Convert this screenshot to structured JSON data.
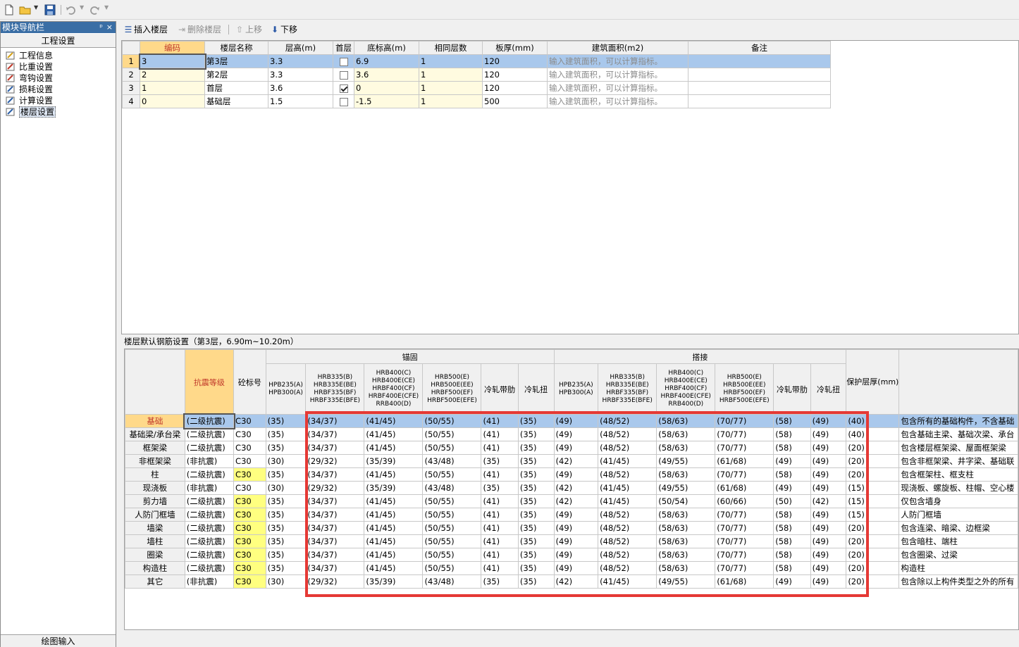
{
  "toolbar": {
    "icons": [
      "new-file-icon",
      "open-folder-icon",
      "save-icon",
      "undo-icon",
      "redo-icon"
    ]
  },
  "nav": {
    "title": "模块导航栏",
    "pin": "ᵖ",
    "close": "×",
    "header": "工程设置",
    "items": [
      {
        "label": "工程信息",
        "icon": "project-info-icon"
      },
      {
        "label": "比重设置",
        "icon": "density-settings-icon"
      },
      {
        "label": "弯钩设置",
        "icon": "hook-settings-icon"
      },
      {
        "label": "损耗设置",
        "icon": "loss-settings-icon"
      },
      {
        "label": "计算设置",
        "icon": "calc-settings-icon"
      },
      {
        "label": "楼层设置",
        "icon": "floor-settings-icon"
      }
    ],
    "bottom_tab": "绘图输入"
  },
  "floor_toolbar": {
    "insert": "插入楼层",
    "delete": "删除楼层",
    "up": "上移",
    "down": "下移"
  },
  "floor_table": {
    "headers": [
      "编码",
      "楼层名称",
      "层高(m)",
      "首层",
      "底标高(m)",
      "相同层数",
      "板厚(mm)",
      "建筑面积(m2)",
      "备注"
    ],
    "rows": [
      {
        "n": "1",
        "code": "3",
        "name": "第3层",
        "height": "3.3",
        "first": false,
        "base": "6.9",
        "same": "1",
        "thick": "120",
        "area": "输入建筑面积，可以计算指标。",
        "note": ""
      },
      {
        "n": "2",
        "code": "2",
        "name": "第2层",
        "height": "3.3",
        "first": false,
        "base": "3.6",
        "same": "1",
        "thick": "120",
        "area": "输入建筑面积，可以计算指标。",
        "note": ""
      },
      {
        "n": "3",
        "code": "1",
        "name": "首层",
        "height": "3.6",
        "first": true,
        "base": "0",
        "same": "1",
        "thick": "120",
        "area": "输入建筑面积，可以计算指标。",
        "note": ""
      },
      {
        "n": "4",
        "code": "0",
        "name": "基础层",
        "height": "1.5",
        "first": false,
        "base": "-1.5",
        "same": "1",
        "thick": "500",
        "area": "输入建筑面积，可以计算指标。",
        "note": ""
      }
    ]
  },
  "caption": "楼层默认钢筋设置（第3层，6.90m~10.20m）",
  "rebar": {
    "group_anchor": "锚固",
    "group_lap": "搭接",
    "h_seismic": "抗震等级",
    "h_concrete": "砼标号",
    "h_cover": "保护层厚(mm)",
    "grades": [
      "HPB235(A)\nHPB300(A)",
      "HRB335(B)\nHRB335E(BE)\nHRBF335(BF)\nHRBF335E(BFE)",
      "HRB400(C)\nHRB400E(CE)\nHRBF400(CF)\nHRBF400E(CFE)\nRRB400(D)",
      "HRB500(E)\nHRB500E(EE)\nHRBF500(EF)\nHRBF500E(EFE)",
      "冷轧带肋",
      "冷轧扭"
    ],
    "rows": [
      {
        "name": "基础",
        "seismic": "(二级抗震)",
        "concrete": "C30",
        "yellow": false,
        "anchor": [
          "(35)",
          "(34/37)",
          "(41/45)",
          "(50/55)",
          "(41)",
          "(35)"
        ],
        "lap": [
          "(49)",
          "(48/52)",
          "(58/63)",
          "(70/77)",
          "(58)",
          "(49)"
        ],
        "cover": "(40)",
        "note": "包含所有的基础构件，不含基础"
      },
      {
        "name": "基础梁/承台梁",
        "seismic": "(二级抗震)",
        "concrete": "C30",
        "yellow": false,
        "anchor": [
          "(35)",
          "(34/37)",
          "(41/45)",
          "(50/55)",
          "(41)",
          "(35)"
        ],
        "lap": [
          "(49)",
          "(48/52)",
          "(58/63)",
          "(70/77)",
          "(58)",
          "(49)"
        ],
        "cover": "(40)",
        "note": "包含基础主梁、基础次梁、承台"
      },
      {
        "name": "框架梁",
        "seismic": "(二级抗震)",
        "concrete": "C30",
        "yellow": false,
        "anchor": [
          "(35)",
          "(34/37)",
          "(41/45)",
          "(50/55)",
          "(41)",
          "(35)"
        ],
        "lap": [
          "(49)",
          "(48/52)",
          "(58/63)",
          "(70/77)",
          "(58)",
          "(49)"
        ],
        "cover": "(20)",
        "note": "包含楼层框架梁、屋面框架梁"
      },
      {
        "name": "非框架梁",
        "seismic": "(非抗震)",
        "concrete": "C30",
        "yellow": false,
        "anchor": [
          "(30)",
          "(29/32)",
          "(35/39)",
          "(43/48)",
          "(35)",
          "(35)"
        ],
        "lap": [
          "(42)",
          "(41/45)",
          "(49/55)",
          "(61/68)",
          "(49)",
          "(49)"
        ],
        "cover": "(20)",
        "note": "包含非框架梁、井字梁、基础联"
      },
      {
        "name": "柱",
        "seismic": "(二级抗震)",
        "concrete": "C30",
        "yellow": true,
        "anchor": [
          "(35)",
          "(34/37)",
          "(41/45)",
          "(50/55)",
          "(41)",
          "(35)"
        ],
        "lap": [
          "(49)",
          "(48/52)",
          "(58/63)",
          "(70/77)",
          "(58)",
          "(49)"
        ],
        "cover": "(20)",
        "note": "包含框架柱、框支柱"
      },
      {
        "name": "现浇板",
        "seismic": "(非抗震)",
        "concrete": "C30",
        "yellow": false,
        "anchor": [
          "(30)",
          "(29/32)",
          "(35/39)",
          "(43/48)",
          "(35)",
          "(35)"
        ],
        "lap": [
          "(42)",
          "(41/45)",
          "(49/55)",
          "(61/68)",
          "(49)",
          "(49)"
        ],
        "cover": "(15)",
        "note": "现浇板、螺旋板、柱帽、空心楼"
      },
      {
        "name": "剪力墙",
        "seismic": "(二级抗震)",
        "concrete": "C30",
        "yellow": true,
        "anchor": [
          "(35)",
          "(34/37)",
          "(41/45)",
          "(50/55)",
          "(41)",
          "(35)"
        ],
        "lap": [
          "(42)",
          "(41/45)",
          "(50/54)",
          "(60/66)",
          "(50)",
          "(42)"
        ],
        "cover": "(15)",
        "note": "仅包含墙身"
      },
      {
        "name": "人防门框墙",
        "seismic": "(二级抗震)",
        "concrete": "C30",
        "yellow": true,
        "anchor": [
          "(35)",
          "(34/37)",
          "(41/45)",
          "(50/55)",
          "(41)",
          "(35)"
        ],
        "lap": [
          "(49)",
          "(48/52)",
          "(58/63)",
          "(70/77)",
          "(58)",
          "(49)"
        ],
        "cover": "(15)",
        "note": "人防门框墙"
      },
      {
        "name": "墙梁",
        "seismic": "(二级抗震)",
        "concrete": "C30",
        "yellow": true,
        "anchor": [
          "(35)",
          "(34/37)",
          "(41/45)",
          "(50/55)",
          "(41)",
          "(35)"
        ],
        "lap": [
          "(49)",
          "(48/52)",
          "(58/63)",
          "(70/77)",
          "(58)",
          "(49)"
        ],
        "cover": "(20)",
        "note": "包含连梁、暗梁、边框梁"
      },
      {
        "name": "墙柱",
        "seismic": "(二级抗震)",
        "concrete": "C30",
        "yellow": true,
        "anchor": [
          "(35)",
          "(34/37)",
          "(41/45)",
          "(50/55)",
          "(41)",
          "(35)"
        ],
        "lap": [
          "(49)",
          "(48/52)",
          "(58/63)",
          "(70/77)",
          "(58)",
          "(49)"
        ],
        "cover": "(20)",
        "note": "包含暗柱、端柱"
      },
      {
        "name": "圈梁",
        "seismic": "(二级抗震)",
        "concrete": "C30",
        "yellow": true,
        "anchor": [
          "(35)",
          "(34/37)",
          "(41/45)",
          "(50/55)",
          "(41)",
          "(35)"
        ],
        "lap": [
          "(49)",
          "(48/52)",
          "(58/63)",
          "(70/77)",
          "(58)",
          "(49)"
        ],
        "cover": "(20)",
        "note": "包含圈梁、过梁"
      },
      {
        "name": "构造柱",
        "seismic": "(二级抗震)",
        "concrete": "C30",
        "yellow": true,
        "anchor": [
          "(35)",
          "(34/37)",
          "(41/45)",
          "(50/55)",
          "(41)",
          "(35)"
        ],
        "lap": [
          "(49)",
          "(48/52)",
          "(58/63)",
          "(70/77)",
          "(58)",
          "(49)"
        ],
        "cover": "(20)",
        "note": "构造柱"
      },
      {
        "name": "其它",
        "seismic": "(非抗震)",
        "concrete": "C30",
        "yellow": true,
        "anchor": [
          "(30)",
          "(29/32)",
          "(35/39)",
          "(43/48)",
          "(35)",
          "(35)"
        ],
        "lap": [
          "(42)",
          "(41/45)",
          "(49/55)",
          "(61/68)",
          "(49)",
          "(49)"
        ],
        "cover": "(20)",
        "note": "包含除以上构件类型之外的所有"
      }
    ]
  },
  "colors": {
    "nav_title": "#3a6ea5",
    "selection": "#a9c8ec",
    "header_highlight": "#ffd98a",
    "concrete_highlight": "#ffff80",
    "annotation": "#e53935"
  }
}
